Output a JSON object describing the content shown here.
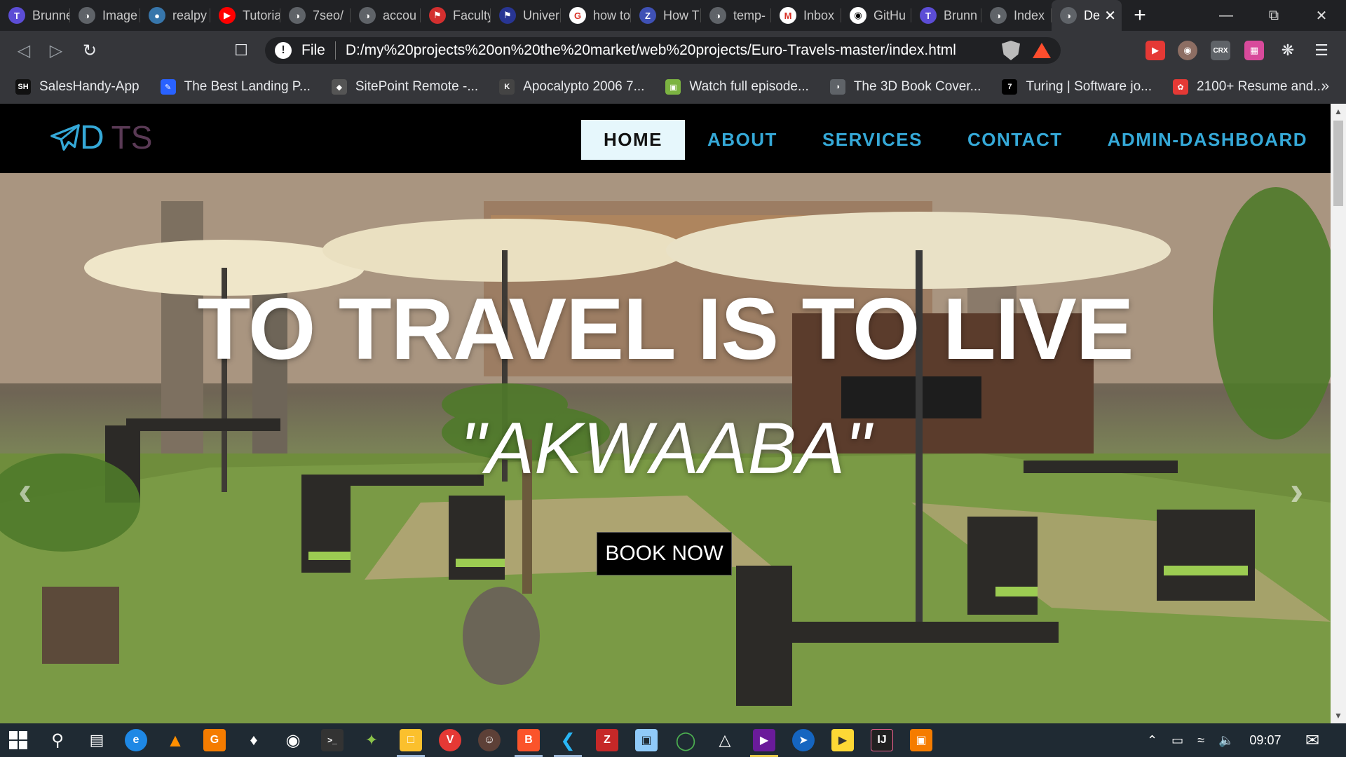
{
  "browser": {
    "tabs": [
      {
        "title": "Brunne",
        "icon": "T"
      },
      {
        "title": "Image",
        "icon": "globe"
      },
      {
        "title": "realpy",
        "icon": "python"
      },
      {
        "title": "Tutoria",
        "icon": "youtube"
      },
      {
        "title": "7seo/",
        "icon": "globe"
      },
      {
        "title": "accou",
        "icon": "globe"
      },
      {
        "title": "Faculty",
        "icon": "shield"
      },
      {
        "title": "Univer",
        "icon": "flag"
      },
      {
        "title": "how to",
        "icon": "google"
      },
      {
        "title": "How T",
        "icon": "zapier"
      },
      {
        "title": "temp-",
        "icon": "globe"
      },
      {
        "title": "Inbox",
        "icon": "gmail"
      },
      {
        "title": "GitHu",
        "icon": "github"
      },
      {
        "title": "Brunn",
        "icon": "T"
      },
      {
        "title": "Index",
        "icon": "globe"
      },
      {
        "title": "De",
        "icon": "globe",
        "active": true
      }
    ],
    "address": {
      "scheme_label": "File",
      "url": "D:/my%20projects%20on%20the%20market/web%20projects/Euro-Travels-master/index.html"
    },
    "bookmarks": [
      {
        "label": "SalesHandy-App",
        "icon": "SH"
      },
      {
        "label": "The Best Landing P...",
        "icon": "pen"
      },
      {
        "label": "SitePoint Remote -...",
        "icon": "sitepoint"
      },
      {
        "label": "Apocalypto 2006 7...",
        "icon": "K"
      },
      {
        "label": "Watch full episode...",
        "icon": "img"
      },
      {
        "label": "The 3D Book Cover...",
        "icon": "globe"
      },
      {
        "label": "Turing | Software jo...",
        "icon": "7"
      },
      {
        "label": "2100+ Resume and...",
        "icon": "swirl"
      }
    ],
    "more_bookmarks": "»"
  },
  "site": {
    "logo": {
      "mark": "D",
      "text": "TS"
    },
    "nav": [
      {
        "label": "HOME",
        "active": true
      },
      {
        "label": "ABOUT"
      },
      {
        "label": "SERVICES"
      },
      {
        "label": "CONTACT"
      },
      {
        "label": "ADMIN-DASHBOARD"
      }
    ],
    "hero": {
      "title": "TO TRAVEL IS TO LIVE",
      "subtitle": "\"AKWAABA\"",
      "cta": "BOOK NOW"
    },
    "colors": {
      "accent": "#35a9d8",
      "nav_bg": "#000000",
      "active_nav_bg": "#e6f7fc"
    }
  },
  "taskbar": {
    "clock": "09:07"
  }
}
